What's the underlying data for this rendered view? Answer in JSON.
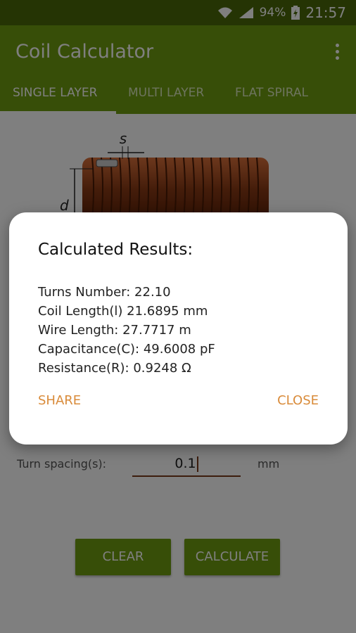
{
  "status": {
    "battery": "94%",
    "time": "21:57"
  },
  "app": {
    "title": "Coil Calculator"
  },
  "tabs": [
    {
      "label": "SINGLE LAYER",
      "active": true
    },
    {
      "label": "MULTI LAYER",
      "active": false
    },
    {
      "label": "FLAT SPIRAL",
      "active": false
    }
  ],
  "diagram": {
    "s_label": "s",
    "d_label": "d"
  },
  "form": {
    "turn_spacing_label": "Turn spacing(s):",
    "turn_spacing_value": "0.1",
    "turn_spacing_unit": "mm"
  },
  "buttons": {
    "clear": "CLEAR",
    "calculate": "CALCULATE"
  },
  "dialog": {
    "title": "Calculated Results:",
    "lines": [
      "Turns Number: 22.10",
      "Coil Length(l) 21.6895 mm",
      "Wire Length: 27.7717 m",
      "Capacitance(C): 49.6008 pF",
      "Resistance(R): 0.9248 Ω"
    ],
    "share": "SHARE",
    "close": "CLOSE"
  },
  "colors": {
    "primary": "#6f9c10",
    "status_bar": "#4a6908",
    "accent": "#d98b3a",
    "coil": "#8a3a15"
  },
  "icons": [
    "wifi-icon",
    "signal-icon",
    "battery-icon",
    "overflow-menu-icon"
  ]
}
